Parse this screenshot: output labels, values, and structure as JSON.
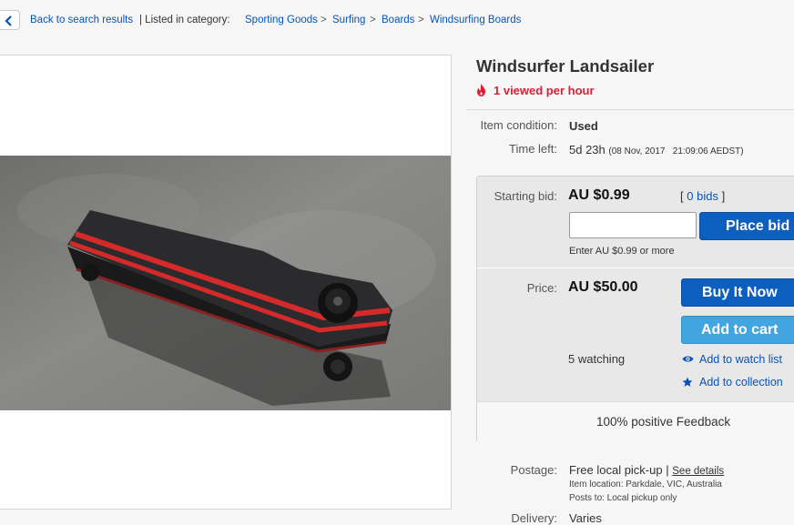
{
  "breadcrumb": {
    "back_label": "Back to search results",
    "listed_in": "| Listed in category:",
    "categories": [
      "Sporting Goods",
      "Surfing",
      "Boards",
      "Windsurfing Boards"
    ],
    "separator": ">"
  },
  "item": {
    "title": "Windsurfer Landsailer",
    "views_badge": "1 viewed per hour",
    "condition_label": "Item condition:",
    "condition_value": "Used",
    "time_left_label": "Time left:",
    "time_left_value": "5d 23h",
    "time_left_end": "(08 Nov, 2017   21:09:06 AEDST)"
  },
  "bidding": {
    "starting_bid_label": "Starting bid:",
    "starting_bid_value": "AU $0.99",
    "bids_link": "0 bids",
    "bids_open": "[",
    "bids_close": "]",
    "bid_input_value": "",
    "place_bid_label": "Place bid",
    "hint": "Enter AU $0.99 or more"
  },
  "buy_now": {
    "price_label": "Price:",
    "price_value": "AU $50.00",
    "buy_button": "Buy It Now",
    "cart_button": "Add to cart",
    "watching": "5 watching",
    "watch_link": "Add to watch list",
    "collection_link": "Add to collection"
  },
  "seller": {
    "feedback": "100% positive Feedback"
  },
  "shipping": {
    "postage_label": "Postage:",
    "postage_value": "Free local pick-up",
    "postage_sep": "|",
    "see_details": "See details",
    "location": "Item location:  Parkdale, VIC, Australia",
    "posts_to": "Posts to:  Local pickup only",
    "delivery_label": "Delivery:",
    "delivery_value": "Varies"
  },
  "colors": {
    "link": "#0654ba",
    "hot": "#dd1e31",
    "button_dark": "#0c5fbf",
    "button_light": "#43a5e0"
  },
  "icons": {
    "back": "chevron-left-icon",
    "hot": "flame-icon",
    "watch": "eye-icon",
    "collection": "star-icon"
  }
}
